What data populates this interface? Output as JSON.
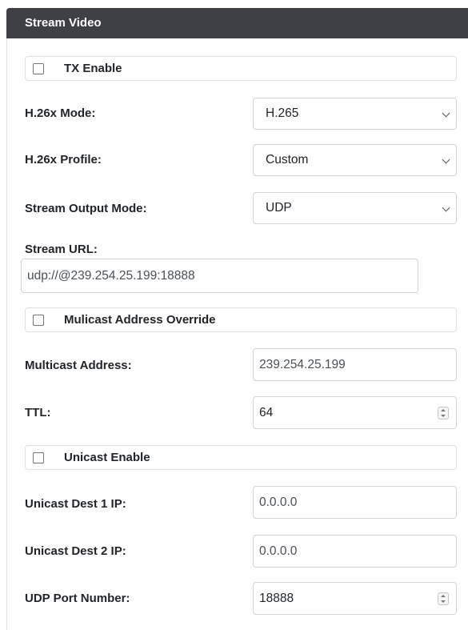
{
  "panel": {
    "title": "Stream Video"
  },
  "tx_enable": {
    "label": "TX Enable",
    "checked": false
  },
  "h26x_mode": {
    "label": "H.26x Mode:",
    "value": "H.265"
  },
  "h26x_profile": {
    "label": "H.26x Profile:",
    "value": "Custom"
  },
  "stream_output_mode": {
    "label": "Stream Output Mode:",
    "value": "UDP"
  },
  "stream_url": {
    "label": "Stream URL:",
    "value": "udp://@239.254.25.199:18888"
  },
  "multicast_override": {
    "label": "Mulicast Address Override",
    "checked": false
  },
  "multicast_address": {
    "label": "Multicast Address:",
    "value": "239.254.25.199"
  },
  "ttl": {
    "label": "TTL:",
    "value": "64"
  },
  "unicast_enable": {
    "label": "Unicast Enable",
    "checked": false
  },
  "unicast_dest1": {
    "label": "Unicast Dest 1 IP:",
    "value": "0.0.0.0"
  },
  "unicast_dest2": {
    "label": "Unicast Dest 2 IP:",
    "value": "0.0.0.0"
  },
  "udp_port": {
    "label": "UDP Port Number:",
    "value": "18888"
  }
}
